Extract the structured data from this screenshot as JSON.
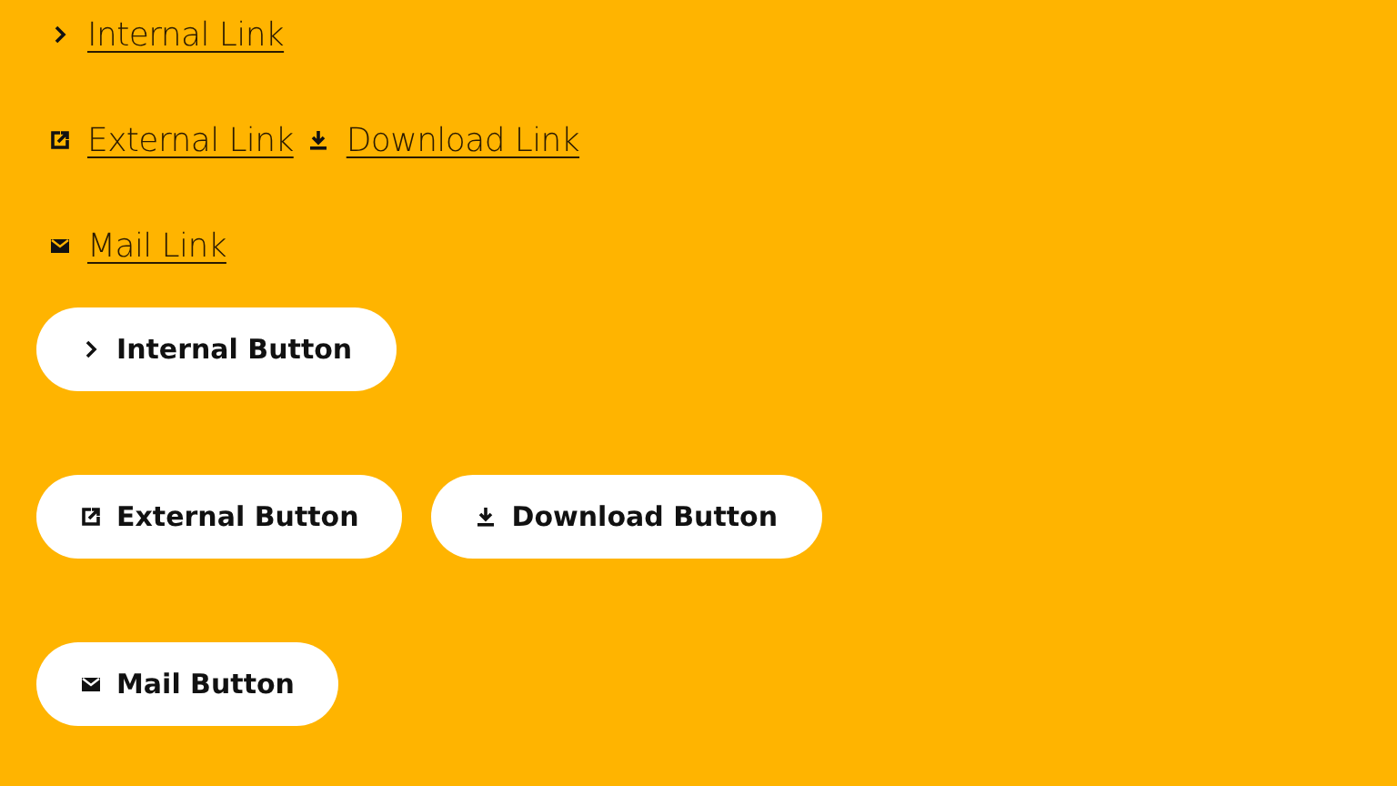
{
  "link_rows": [
    [
      {
        "kind": "internal",
        "label": "Internal Link"
      }
    ],
    [
      {
        "kind": "external",
        "label": "External Link"
      },
      {
        "kind": "download",
        "label": "Download Link"
      }
    ],
    [
      {
        "kind": "mail",
        "label": "Mail Link"
      }
    ]
  ],
  "button_rows": [
    [
      {
        "kind": "internal",
        "label": "Internal Button"
      }
    ],
    [
      {
        "kind": "external",
        "label": "External Button"
      },
      {
        "kind": "download",
        "label": "Download Button"
      }
    ],
    [
      {
        "kind": "mail",
        "label": "Mail Button"
      }
    ]
  ]
}
